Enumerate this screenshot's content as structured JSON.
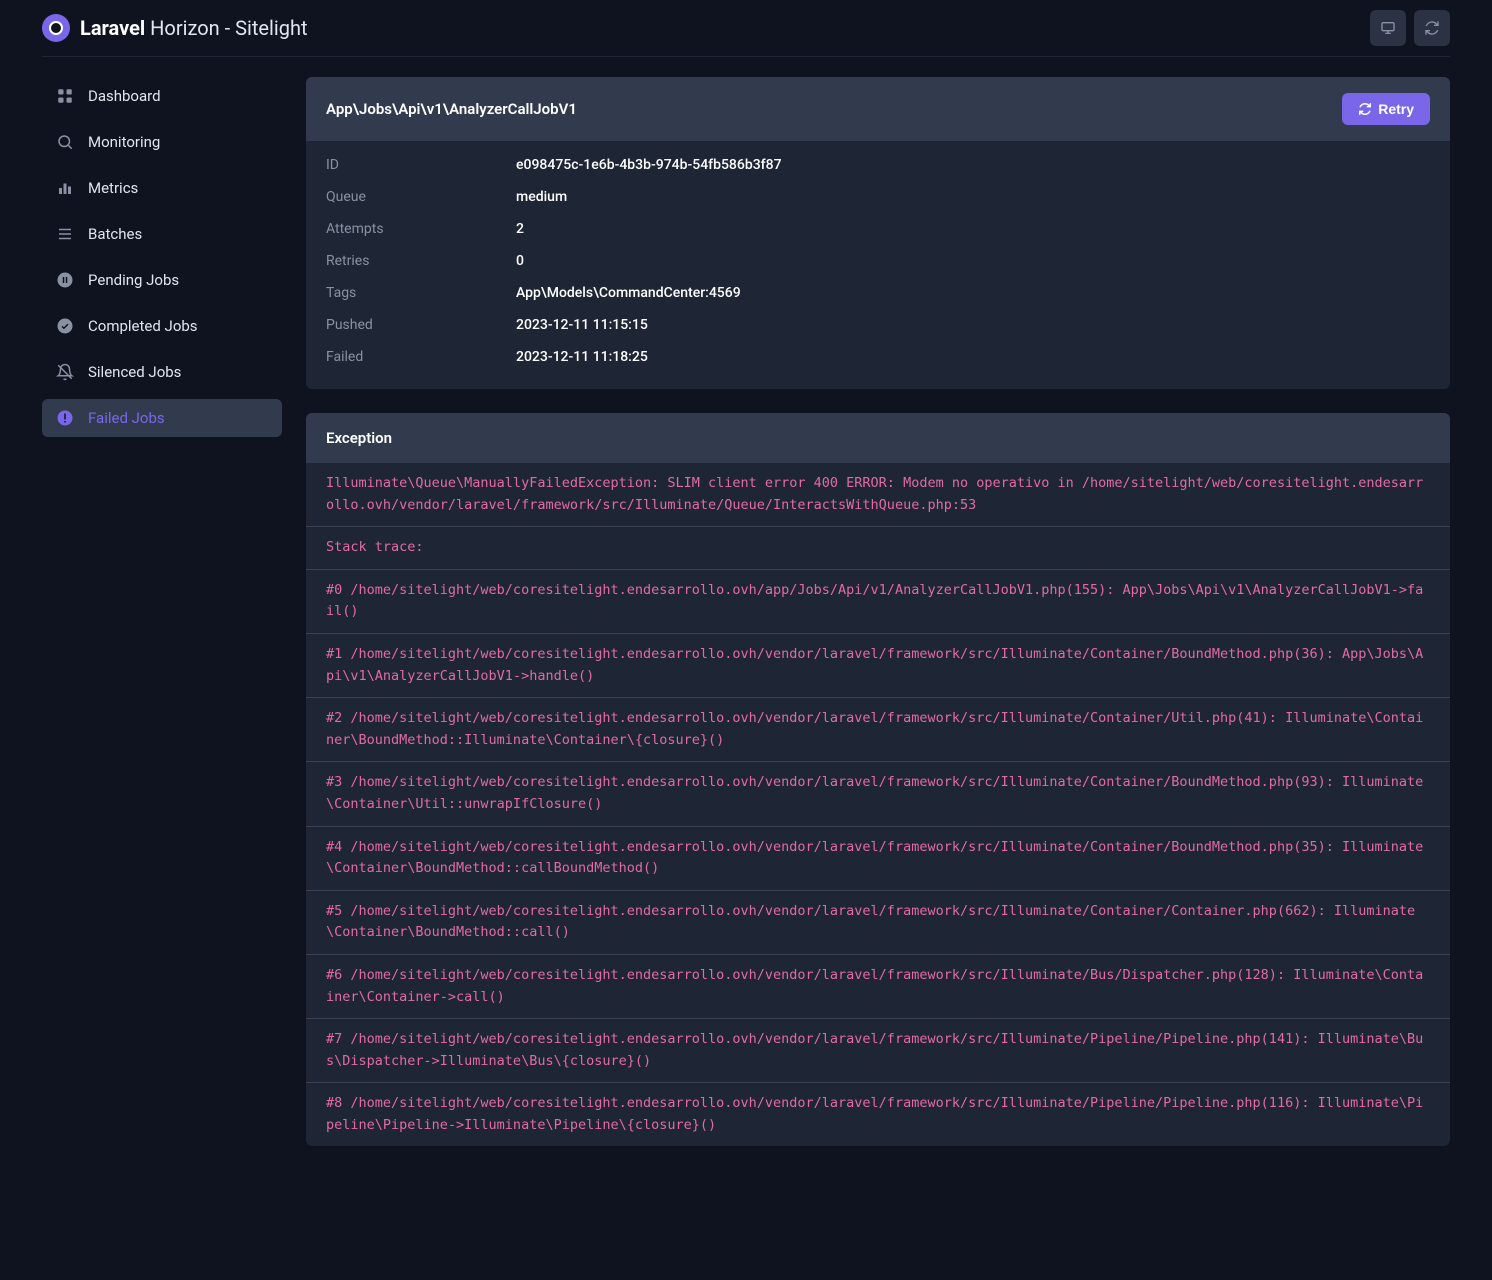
{
  "brand": {
    "strong": "Laravel",
    "rest": " Horizon - Sitelight"
  },
  "sidebar": {
    "items": [
      {
        "id": "dashboard",
        "label": "Dashboard",
        "icon": "grid",
        "active": false
      },
      {
        "id": "monitoring",
        "label": "Monitoring",
        "icon": "search",
        "active": false
      },
      {
        "id": "metrics",
        "label": "Metrics",
        "icon": "bars",
        "active": false
      },
      {
        "id": "batches",
        "label": "Batches",
        "icon": "list",
        "active": false
      },
      {
        "id": "pending",
        "label": "Pending Jobs",
        "icon": "pause",
        "active": false
      },
      {
        "id": "completed",
        "label": "Completed Jobs",
        "icon": "check",
        "active": false
      },
      {
        "id": "silenced",
        "label": "Silenced Jobs",
        "icon": "bell-off",
        "active": false
      },
      {
        "id": "failed",
        "label": "Failed Jobs",
        "icon": "alert",
        "active": true
      }
    ]
  },
  "job": {
    "title": "App\\Jobs\\Api\\v1\\AnalyzerCallJobV1",
    "retry_label": "Retry",
    "fields": [
      {
        "key": "ID",
        "value": "e098475c-1e6b-4b3b-974b-54fb586b3f87"
      },
      {
        "key": "Queue",
        "value": "medium"
      },
      {
        "key": "Attempts",
        "value": "2"
      },
      {
        "key": "Retries",
        "value": "0"
      },
      {
        "key": "Tags",
        "value": "App\\Models\\CommandCenter:4569"
      },
      {
        "key": "Pushed",
        "value": "2023-12-11 11:15:15"
      },
      {
        "key": "Failed",
        "value": "2023-12-11 11:18:25"
      }
    ]
  },
  "exception": {
    "title": "Exception",
    "lines": [
      "Illuminate\\Queue\\ManuallyFailedException: SLIM client error 400 ERROR: Modem no operativo in /home/sitelight/web/coresitelight.endesarrollo.ovh/vendor/laravel/framework/src/Illuminate/Queue/InteractsWithQueue.php:53",
      "Stack trace:",
      "#0 /home/sitelight/web/coresitelight.endesarrollo.ovh/app/Jobs/Api/v1/AnalyzerCallJobV1.php(155): App\\Jobs\\Api\\v1\\AnalyzerCallJobV1->fail()",
      "#1 /home/sitelight/web/coresitelight.endesarrollo.ovh/vendor/laravel/framework/src/Illuminate/Container/BoundMethod.php(36): App\\Jobs\\Api\\v1\\AnalyzerCallJobV1->handle()",
      "#2 /home/sitelight/web/coresitelight.endesarrollo.ovh/vendor/laravel/framework/src/Illuminate/Container/Util.php(41): Illuminate\\Container\\BoundMethod::Illuminate\\Container\\{closure}()",
      "#3 /home/sitelight/web/coresitelight.endesarrollo.ovh/vendor/laravel/framework/src/Illuminate/Container/BoundMethod.php(93): Illuminate\\Container\\Util::unwrapIfClosure()",
      "#4 /home/sitelight/web/coresitelight.endesarrollo.ovh/vendor/laravel/framework/src/Illuminate/Container/BoundMethod.php(35): Illuminate\\Container\\BoundMethod::callBoundMethod()",
      "#5 /home/sitelight/web/coresitelight.endesarrollo.ovh/vendor/laravel/framework/src/Illuminate/Container/Container.php(662): Illuminate\\Container\\BoundMethod::call()",
      "#6 /home/sitelight/web/coresitelight.endesarrollo.ovh/vendor/laravel/framework/src/Illuminate/Bus/Dispatcher.php(128): Illuminate\\Container\\Container->call()",
      "#7 /home/sitelight/web/coresitelight.endesarrollo.ovh/vendor/laravel/framework/src/Illuminate/Pipeline/Pipeline.php(141): Illuminate\\Bus\\Dispatcher->Illuminate\\Bus\\{closure}()",
      "#8 /home/sitelight/web/coresitelight.endesarrollo.ovh/vendor/laravel/framework/src/Illuminate/Pipeline/Pipeline.php(116): Illuminate\\Pipeline\\Pipeline->Illuminate\\Pipeline\\{closure}()"
    ]
  }
}
